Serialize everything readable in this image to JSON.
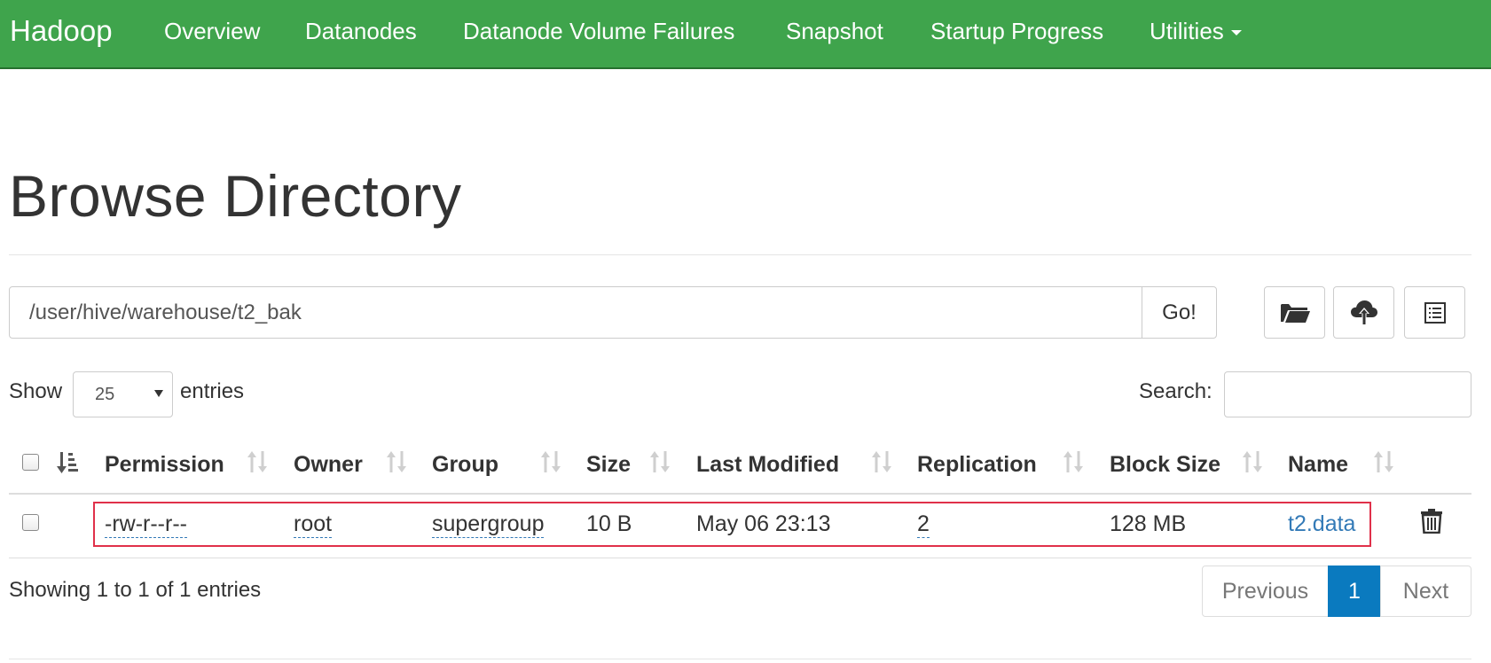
{
  "navbar": {
    "brand": "Hadoop",
    "items": [
      "Overview",
      "Datanodes",
      "Datanode Volume Failures",
      "Snapshot",
      "Startup Progress",
      "Utilities"
    ]
  },
  "page": {
    "title": "Browse Directory"
  },
  "path_form": {
    "path_value": "/user/hive/warehouse/t2_bak",
    "go_label": "Go!",
    "icons": [
      "folder-open-icon",
      "cloud-upload-icon",
      "list-icon"
    ]
  },
  "entries_control": {
    "show_label": "Show",
    "selected": "25",
    "entries_label": "entries",
    "search_label": "Search:"
  },
  "table": {
    "columns": [
      "Permission",
      "Owner",
      "Group",
      "Size",
      "Last Modified",
      "Replication",
      "Block Size",
      "Name"
    ],
    "rows": [
      {
        "permission": "-rw-r--r--",
        "owner": "root",
        "group": "supergroup",
        "size": "10 B",
        "last_modified": "May 06 23:13",
        "replication": "2",
        "block_size": "128 MB",
        "name": "t2.data"
      }
    ]
  },
  "footer": {
    "info": "Showing 1 to 1 of 1 entries",
    "pagination": {
      "previous": "Previous",
      "current": "1",
      "next": "Next"
    }
  },
  "colors": {
    "navbar": "#3fa44c",
    "link": "#337ab7",
    "active_page": "#0a7abf",
    "highlight": "#e0304a"
  }
}
